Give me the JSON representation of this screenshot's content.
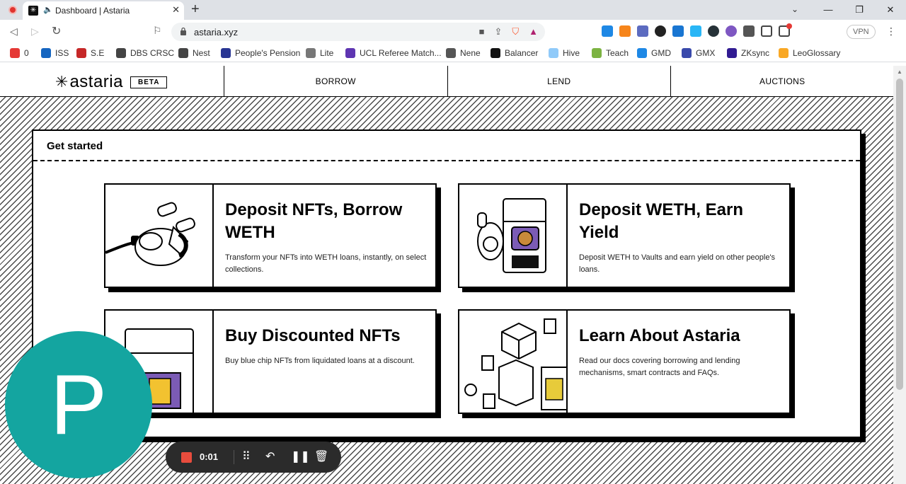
{
  "browser": {
    "tab_title": "Dashboard | Astaria",
    "url": "astaria.xyz",
    "vpn_label": "VPN",
    "bookmarks": [
      {
        "label": "0",
        "icon": "chart-icon",
        "color": "#e53935"
      },
      {
        "label": "ISS",
        "icon": "iss-icon",
        "color": "#1565c0"
      },
      {
        "label": "S.E",
        "icon": "se-icon",
        "color": "#c62828"
      },
      {
        "label": "DBS CRSC",
        "icon": "globe-icon",
        "color": "#444444"
      },
      {
        "label": "Nest",
        "icon": "globe-icon",
        "color": "#444444"
      },
      {
        "label": "People's Pension",
        "icon": "pension-icon",
        "color": "#283593"
      },
      {
        "label": "Lite",
        "icon": "lite-icon",
        "color": "#777777"
      },
      {
        "label": "UCL Referee Match...",
        "icon": "ucl-icon",
        "color": "#5e35b1"
      },
      {
        "label": "Nene",
        "icon": "nene-icon",
        "color": "#555555"
      },
      {
        "label": "Balancer",
        "icon": "balancer-icon",
        "color": "#111111"
      },
      {
        "label": "Hive",
        "icon": "hive-icon",
        "color": "#90caf9"
      },
      {
        "label": "Teach",
        "icon": "teach-icon",
        "color": "#7cb342"
      },
      {
        "label": "GMD",
        "icon": "gmd-icon",
        "color": "#1e88e5"
      },
      {
        "label": "GMX",
        "icon": "gmx-icon",
        "color": "#3949ab"
      },
      {
        "label": "ZKsync",
        "icon": "zksync-icon",
        "color": "#311b92"
      },
      {
        "label": "LeoGlossary",
        "icon": "leo-icon",
        "color": "#f9a825"
      }
    ]
  },
  "site": {
    "logo_text": "astaria",
    "beta_label": "BETA",
    "nav": [
      "BORROW",
      "LEND",
      "AUCTIONS"
    ]
  },
  "panel": {
    "heading": "Get started",
    "cards": [
      {
        "title": "Deposit NFTs, Borrow WETH",
        "description": "Transform your NFTs into WETH loans, instantly, on select collections."
      },
      {
        "title": "Deposit WETH, Earn Yield",
        "description": "Deposit WETH to Vaults and earn yield on other people's loans."
      },
      {
        "title": "Buy Discounted NFTs",
        "description": "Buy blue chip NFTs from liquidated loans at a discount."
      },
      {
        "title": "Learn About Astaria",
        "description": "Read our docs covering borrowing and lending mechanisms, smart contracts and FAQs."
      }
    ]
  },
  "overlay": {
    "avatar_letter": "P",
    "recorder_time": "0:01"
  },
  "colors": {
    "avatar": "#14a5a0",
    "record": "#e84c3d",
    "recorder_bg": "#2b2b2b"
  }
}
